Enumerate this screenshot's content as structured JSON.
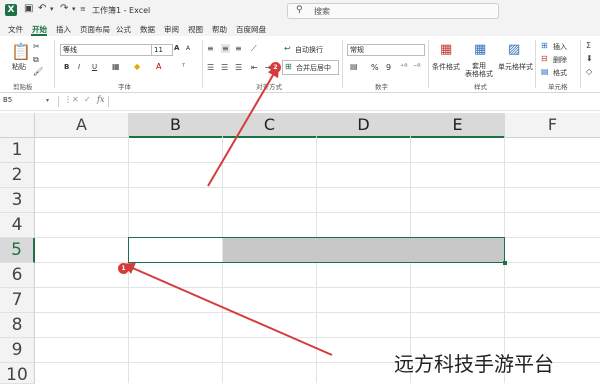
{
  "titlebar": {
    "app_icon": "X",
    "autosave_label": "",
    "title": "工作簿1 - Excel",
    "search_placeholder": "搜索"
  },
  "tabs": [
    "文件",
    "开始",
    "插入",
    "页面布局",
    "公式",
    "数据",
    "审阅",
    "视图",
    "帮助",
    "百度网盘"
  ],
  "active_tab": "开始",
  "ribbon": {
    "clipboard": {
      "paste": "粘贴",
      "label": "剪贴板"
    },
    "font": {
      "name": "等线",
      "size": "11",
      "bold": "B",
      "italic": "I",
      "underline": "U",
      "grow": "A",
      "shrink": "A",
      "label": "字体"
    },
    "alignment": {
      "wrap": "自动换行",
      "merge": "合并后居中",
      "label": "对齐方式"
    },
    "number": {
      "format": "常规",
      "percent": "%",
      "comma": "9",
      "label": "数字"
    },
    "styles": {
      "conditional": "条件格式",
      "table": "套用\n表格格式",
      "cell": "单元格样式",
      "label": "样式"
    },
    "cells": {
      "insert": "插入",
      "delete": "删除",
      "format": "格式",
      "label": "单元格"
    }
  },
  "formula_bar": {
    "name_box": "B5",
    "fx": "fx",
    "value": ""
  },
  "columns": [
    "A",
    "B",
    "C",
    "D",
    "E",
    "F"
  ],
  "rows": [
    "1",
    "2",
    "3",
    "4",
    "5",
    "6",
    "7",
    "8",
    "9",
    "10"
  ],
  "selection": {
    "range": "B5:E5",
    "active_cell": "B5"
  },
  "annotations": {
    "badge_1": "1",
    "badge_2": "2"
  },
  "watermark": "远方科技手游平台",
  "colors": {
    "excel_green": "#1e7145",
    "arrow_red": "#d63b3b",
    "selection_fill": "#c8c8c8"
  }
}
